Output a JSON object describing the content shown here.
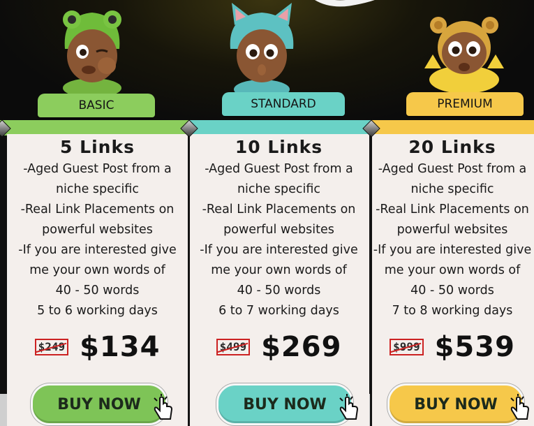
{
  "colors": {
    "basic": "#8ccd5d",
    "standard": "#6ad2c6",
    "premium": "#f6c84a",
    "strike": "#cc2222"
  },
  "plans": [
    {
      "tier": "BASIC",
      "links": "5 Links",
      "features": [
        "-Aged Guest Post from a",
        "niche specific",
        "-Real  Link Placements on",
        "powerful websites",
        "-If you are interested give",
        "me your own words of",
        "40 - 50 words",
        "5 to 6 working days"
      ],
      "old_price": "$249",
      "price": "$134",
      "button": "BUY NOW"
    },
    {
      "tier": "STANDARD",
      "links": "10 Links",
      "features": [
        "-Aged Guest Post from a",
        "niche specific",
        "-Real  Link Placements on",
        "powerful websites",
        "-If you are interested give",
        "me your own words of",
        "40 - 50 words",
        "6 to 7 working days"
      ],
      "old_price": "$499",
      "price": "$269",
      "button": "BUY NOW"
    },
    {
      "tier": "PREMIUM",
      "links": "20 Links",
      "features": [
        "-Aged Guest Post from a",
        "niche specific",
        "-Real  Link Placements on",
        "powerful websites",
        "-If you are interested give",
        "me your own words of",
        "40 - 50 words",
        "7 to 8 working days"
      ],
      "old_price": "$999",
      "price": "$539",
      "button": "BUY NOW"
    }
  ]
}
